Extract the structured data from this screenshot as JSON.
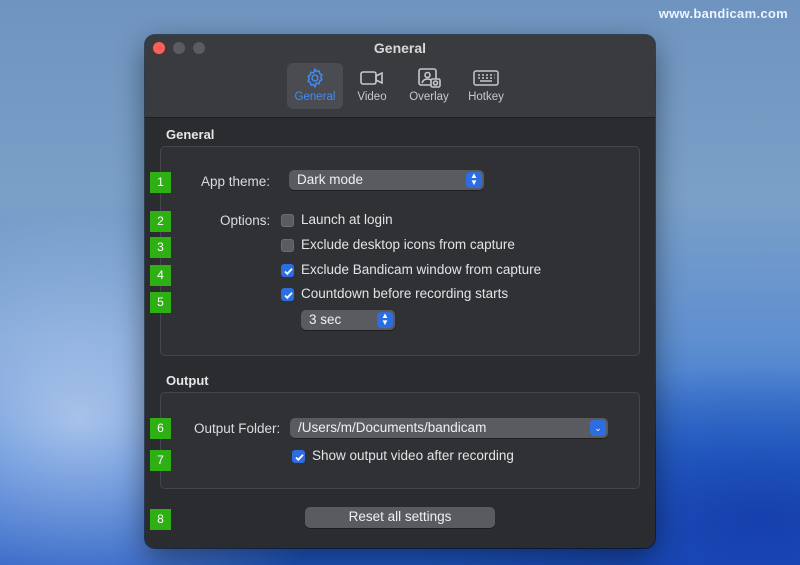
{
  "watermark": "www.bandicam.com",
  "window": {
    "title": "General"
  },
  "tabs": [
    {
      "label": "General",
      "icon": "gear-icon",
      "active": true
    },
    {
      "label": "Video",
      "icon": "video-camera-icon",
      "active": false
    },
    {
      "label": "Overlay",
      "icon": "overlay-image-icon",
      "active": false
    },
    {
      "label": "Hotkey",
      "icon": "keyboard-icon",
      "active": false
    }
  ],
  "general": {
    "section_title": "General",
    "app_theme_label": "App theme:",
    "app_theme_value": "Dark mode",
    "options_label": "Options:",
    "options": [
      {
        "label": "Launch at login",
        "checked": false
      },
      {
        "label": "Exclude desktop icons from capture",
        "checked": false
      },
      {
        "label": "Exclude Bandicam window from capture",
        "checked": true
      },
      {
        "label": "Countdown before recording starts",
        "checked": true
      }
    ],
    "countdown_value": "3 sec"
  },
  "output": {
    "section_title": "Output",
    "folder_label": "Output Folder:",
    "folder_value": "/Users/m/Documents/bandicam",
    "show_after_label": "Show output video after recording",
    "show_after_checked": true
  },
  "reset_label": "Reset all settings",
  "badges": [
    "1",
    "2",
    "3",
    "4",
    "5",
    "6",
    "7",
    "8"
  ],
  "colors": {
    "accent": "#2c6ddf",
    "active_tab_text": "#3d8ef7",
    "badge": "#2eb014"
  }
}
